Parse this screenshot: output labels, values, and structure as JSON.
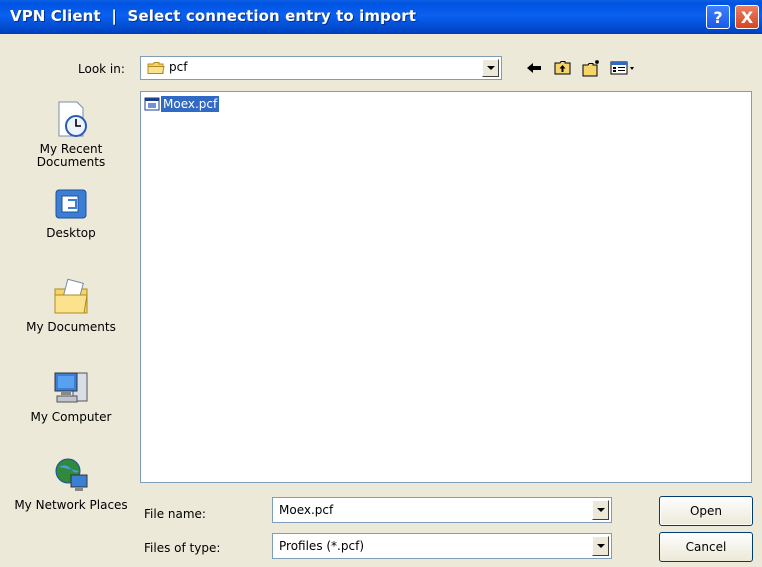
{
  "window": {
    "title": "VPN Client  |  Select connection entry to import",
    "help_label": "?",
    "close_label": "X"
  },
  "lookin": {
    "label": "Look in:",
    "value": "pcf"
  },
  "places": [
    {
      "label": "My Recent Documents",
      "icon": "recent-documents-icon"
    },
    {
      "label": "Desktop",
      "icon": "desktop-icon"
    },
    {
      "label": "My Documents",
      "icon": "my-documents-icon"
    },
    {
      "label": "My Computer",
      "icon": "my-computer-icon"
    },
    {
      "label": "My Network Places",
      "icon": "network-places-icon"
    }
  ],
  "files": [
    {
      "name": "Moex.pcf",
      "selected": true
    }
  ],
  "filename": {
    "label": "File name:",
    "value": "Moex.pcf"
  },
  "filetype": {
    "label": "Files of type:",
    "value": "Profiles (*.pcf)"
  },
  "buttons": {
    "open": "Open",
    "cancel": "Cancel"
  },
  "colors": {
    "titlebar": "#0054e3",
    "selection": "#316ac5",
    "dialog_bg": "#ece9d8"
  }
}
